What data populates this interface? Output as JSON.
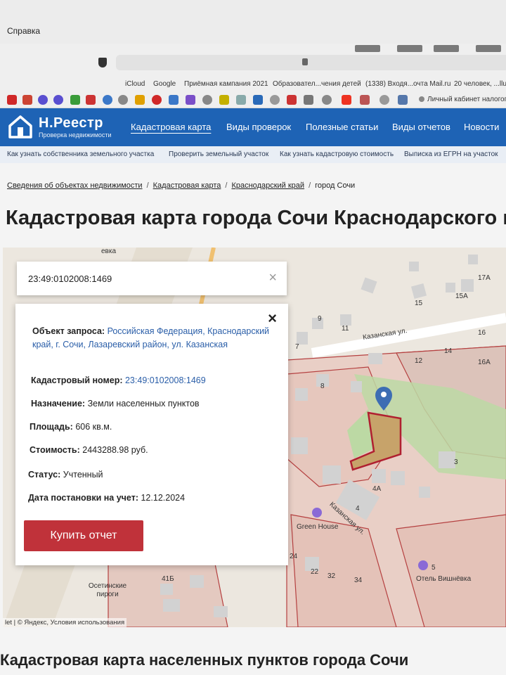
{
  "menubar": {
    "help_menu": "Справка"
  },
  "bookmarks": [
    "iCloud",
    "Google",
    "Приёмная кампания 2021",
    "Образовател...чения детей",
    "(1338) Входя...очта Mail.ru",
    "20 человек, ...llu"
  ],
  "favbar": {
    "link": "Личный кабинет налогоп"
  },
  "header": {
    "logo_title": "Н.Реестр",
    "logo_subtitle": "Проверка недвижимости",
    "nav": [
      "Кадастровая карта",
      "Виды проверок",
      "Полезные статьи",
      "Виды отчетов",
      "Новости"
    ]
  },
  "subnav": [
    "Как узнать собственника земельного участка",
    "Проверить земельный участок",
    "Как узнать кадастровую стоимость",
    "Выписка из ЕГРН на участок"
  ],
  "breadcrumb": {
    "items": [
      "Сведения об объектах недвижимости",
      "Кадастровая карта",
      "Краснодарский край"
    ],
    "current": "город Сочи"
  },
  "page_title": "Кадастровая карта города Сочи Краснодарского края",
  "search": {
    "value": "23:49:0102008:1469",
    "close": "×"
  },
  "card": {
    "close": "×",
    "object_label": "Объект запроса:",
    "object_value": "Российская Федерация, Краснодарский край, г. Сочи, Лазаревский район, ул. Казанская",
    "cadastral_label": "Кадастровый номер:",
    "cadastral_value": "23:49:0102008:1469",
    "purpose_label": "Назначение:",
    "purpose_value": "Земли населенных пунктов",
    "area_label": "Площадь:",
    "area_value": "606 кв.м.",
    "cost_label": "Стоимость:",
    "cost_value": "2443288.98 руб.",
    "status_label": "Статус:",
    "status_value": "Учтенный",
    "date_label": "Дата постановки на учет:",
    "date_value": "12.12.2024",
    "buy_button": "Купить отчет"
  },
  "map": {
    "street_1": "Казанская ул.",
    "street_2": "Казанская ул.",
    "top_street": "евка",
    "poi_1": "Green House",
    "poi_2": "Осетинские пироги",
    "poi_3": "Отель Вишнёвка",
    "house_numbers": [
      "17А",
      "15",
      "15А",
      "9",
      "11",
      "16",
      "7",
      "14",
      "12",
      "16А",
      "8",
      "3",
      "4А",
      "4",
      "24",
      "22",
      "5",
      "41Б",
      "32",
      "34"
    ],
    "copyright": "let | © Яндекс, Условия использования"
  },
  "section_title": "Кадастровая карта населенных пунктов города Сочи",
  "colors": {
    "header": "#1e63b5",
    "button": "#c0323a",
    "link": "#2a5ea8",
    "marker": "#3d6db3"
  }
}
